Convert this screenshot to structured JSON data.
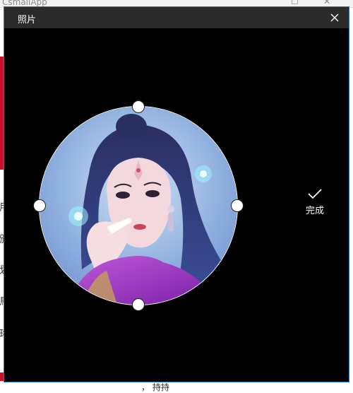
{
  "background_app": {
    "title": "CsmallApp",
    "minimize_glyph": "☐",
    "close_glyph": "✕",
    "side_glyphs": [
      "用",
      "颁",
      "划",
      "鳥",
      "珞"
    ],
    "bottom_text": "，  持持"
  },
  "dialog": {
    "title": "照片",
    "close_icon": "close-icon",
    "done_label": "完成",
    "done_icon": "checkmark-icon",
    "colors": {
      "header": "#2b2b2b",
      "body": "#000000",
      "accent_border": "#2b79c5",
      "text": "#ffffff"
    }
  }
}
